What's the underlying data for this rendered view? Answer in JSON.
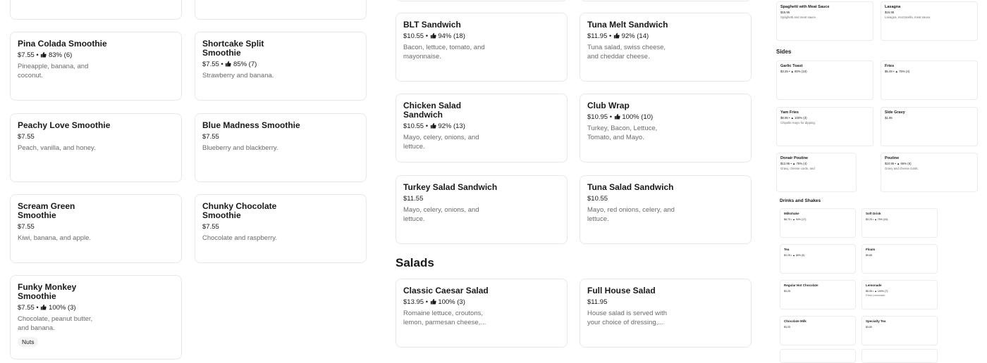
{
  "smoothies_left": [
    {
      "name_l1": "Pina Colada Smoothie",
      "name_l2": "",
      "price": "$7.55",
      "rating": "83% (6)",
      "desc_l1": "Pineapple, banana, and",
      "desc_l2": "coconut."
    },
    {
      "name_l1": "Peachy Love Smoothie",
      "name_l2": "",
      "price": "$7.55",
      "rating": "",
      "desc_l1": "Peach, vanilla, and honey.",
      "desc_l2": ""
    },
    {
      "name_l1": "Scream Green",
      "name_l2": "Smoothie",
      "price": "$7.55",
      "rating": "",
      "desc_l1": "Kiwi, banana, and apple.",
      "desc_l2": ""
    },
    {
      "name_l1": "Funky Monkey",
      "name_l2": "Smoothie",
      "price": "$7.55",
      "rating": "100% (3)",
      "desc_l1": "Chocolate, peanut butter,",
      "desc_l2": "and banana.",
      "tag": "Nuts"
    }
  ],
  "smoothies_right": [
    {
      "name_l1": "Shortcake Split",
      "name_l2": "Smoothie",
      "price": "$7.55",
      "rating": "85% (7)",
      "desc_l1": "Strawberry and banana.",
      "desc_l2": ""
    },
    {
      "name_l1": "Blue Madness Smoothie",
      "name_l2": "",
      "price": "$7.55",
      "rating": "",
      "desc_l1": "Blueberry and blackberry.",
      "desc_l2": ""
    },
    {
      "name_l1": "Chunky Chocolate",
      "name_l2": "Smoothie",
      "price": "$7.55",
      "rating": "",
      "desc_l1": "Chocolate and raspberry.",
      "desc_l2": ""
    }
  ],
  "sandwiches_left": [
    {
      "name_l1": "BLT Sandwich",
      "name_l2": "",
      "price": "$10.55",
      "rating": "94% (18)",
      "desc_l1": "Bacon, lettuce, tomato, and",
      "desc_l2": "mayonnaise."
    },
    {
      "name_l1": "Chicken Salad",
      "name_l2": "Sandwich",
      "price": "$10.55",
      "rating": "92% (13)",
      "desc_l1": "Mayo, celery, onions, and",
      "desc_l2": "lettuce."
    },
    {
      "name_l1": "Turkey Salad Sandwich",
      "name_l2": "",
      "price": "$11.55",
      "rating": "",
      "desc_l1": "Mayo, celery, onions, and",
      "desc_l2": "lettuce."
    }
  ],
  "sandwiches_right": [
    {
      "name_l1": "Tuna Melt Sandwich",
      "name_l2": "",
      "price": "$11.95",
      "rating": "92% (14)",
      "desc_l1": "Tuna salad, swiss cheese,",
      "desc_l2": "and cheddar cheese."
    },
    {
      "name_l1": "Club Wrap",
      "name_l2": "",
      "price": "$10.95",
      "rating": "100% (10)",
      "desc_l1": "Turkey, Bacon, Lettuce,",
      "desc_l2": "Tomato, and Mayo."
    },
    {
      "name_l1": "Tuna Salad Sandwich",
      "name_l2": "",
      "price": "$10.55",
      "rating": "",
      "desc_l1": "Mayo, red onions, celery, and",
      "desc_l2": "lettuce."
    }
  ],
  "salads_heading": "Salads",
  "salads": [
    {
      "name_l1": "Classic Caesar Salad",
      "name_l2": "",
      "price": "$13.95",
      "rating": "100% (3)",
      "desc_l1": "Romaine lettuce, croutons,",
      "desc_l2": "lemon, parmesan cheese,..."
    },
    {
      "name_l1": "Full House Salad",
      "name_l2": "",
      "price": "$11.95",
      "rating": "",
      "desc_l1": "House salad is served with",
      "desc_l2": "your choice of dressing,..."
    }
  ],
  "mini_top": [
    {
      "name": "Spaghetti with Meat Sauce",
      "price": "$15.95",
      "rating": "",
      "desc": "Spaghetti and meat sauce."
    },
    {
      "name": "Lasagna",
      "price": "$16.95",
      "rating": "",
      "desc": "Lasagna, mozzarella, meat sauce."
    }
  ],
  "sides_heading": "Sides",
  "sides": [
    {
      "name": "Garlic Toast",
      "price": "$3.25",
      "rating": "80% (10)",
      "desc": ""
    },
    {
      "name": "Fries",
      "price": "$5.49",
      "rating": "75% (4)",
      "desc": ""
    },
    {
      "name": "Yam Fries",
      "price": "$8.95",
      "rating": "100% (3)",
      "desc": "Chipotle mayo for dipping."
    },
    {
      "name": "Side Gravy",
      "price": "$1.95",
      "rating": "",
      "desc": ""
    },
    {
      "name": "Donair Poutine",
      "price": "$12.95",
      "rating": "75% (4)",
      "desc": "Gravy, cheese curds, and"
    },
    {
      "name": "Poutine",
      "price": "$10.95",
      "rating": "66% (6)",
      "desc": "Gravy and cheese curds."
    }
  ],
  "drinks_heading": "Drinks and Shakes",
  "drinks": [
    {
      "name": "Milkshake",
      "price": "$8.75",
      "rating": "94% (17)",
      "desc": ""
    },
    {
      "name": "Soft Drink",
      "price": "$3.25",
      "rating": "79% (24)",
      "desc": ""
    },
    {
      "name": "Tea",
      "price": "$3.25",
      "rating": "80% (5)",
      "desc": ""
    },
    {
      "name": "Floats",
      "price": "$9.85",
      "rating": "",
      "desc": ""
    },
    {
      "name": "Regular Hot Chocolate",
      "price": "$3.25",
      "rating": "",
      "desc": ""
    },
    {
      "name": "Lemonade",
      "price": "$5.55",
      "rating": "100% (7)",
      "desc": "Fresh Lemonade."
    },
    {
      "name": "Chocolate Milk",
      "price": "$3.25",
      "rating": "",
      "desc": ""
    },
    {
      "name": "Specialty Tea",
      "price": "$3.80",
      "rating": "",
      "desc": ""
    }
  ],
  "icons": {
    "rating": "thumbs-up-icon"
  }
}
